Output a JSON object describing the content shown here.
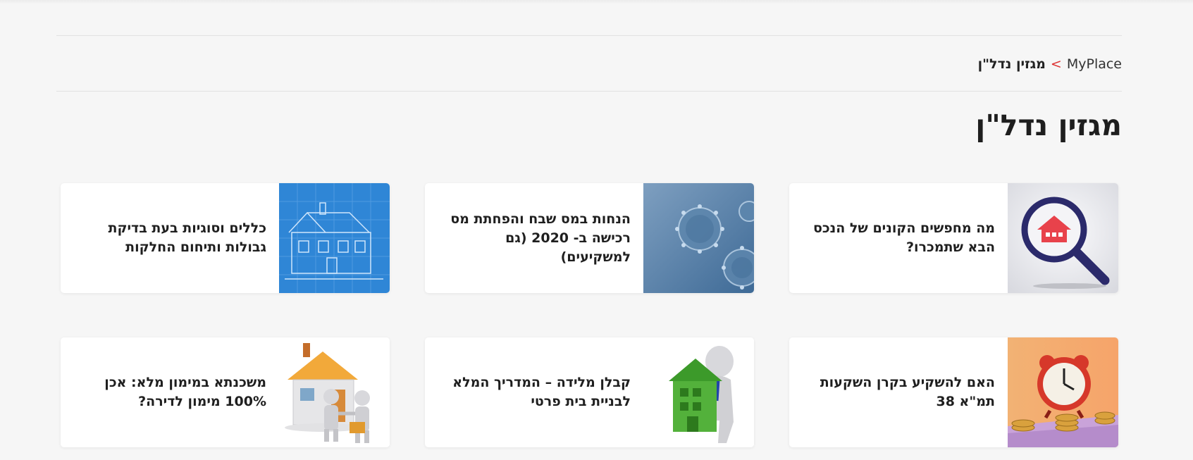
{
  "breadcrumb": {
    "home": "MyPlace",
    "separator": ">",
    "current": "מגזין נדל\"ן"
  },
  "page_title": "מגזין נדל\"ן",
  "colors": {
    "accent": "#d33333",
    "background": "#f6f6f6",
    "card": "#ffffff"
  },
  "articles": [
    {
      "title": "מה מחפשים הקונים של הנכס הבא שתמכרו?",
      "image": "magnifier-house-icon"
    },
    {
      "title": "הנחות במס שבח והפחתת מס רכישה ב- 2020 (גם למשקיעים)",
      "image": "virus-dollar-image"
    },
    {
      "title": "כללים וסוגיות בעת בדיקת גבולות ותיחום החלקות",
      "image": "blueprint-house-image"
    },
    {
      "title": "האם להשקיע בקרן השקעות תמ\"א 38",
      "image": "alarm-clock-coins-image"
    },
    {
      "title": "קבלן מלידה – המדריך המלא לבניית בית פרטי",
      "image": "figure-green-house-image"
    },
    {
      "title": "משכנתא במימון מלא: אכן 100% מימון לדירה?",
      "image": "house-handshake-image"
    }
  ]
}
